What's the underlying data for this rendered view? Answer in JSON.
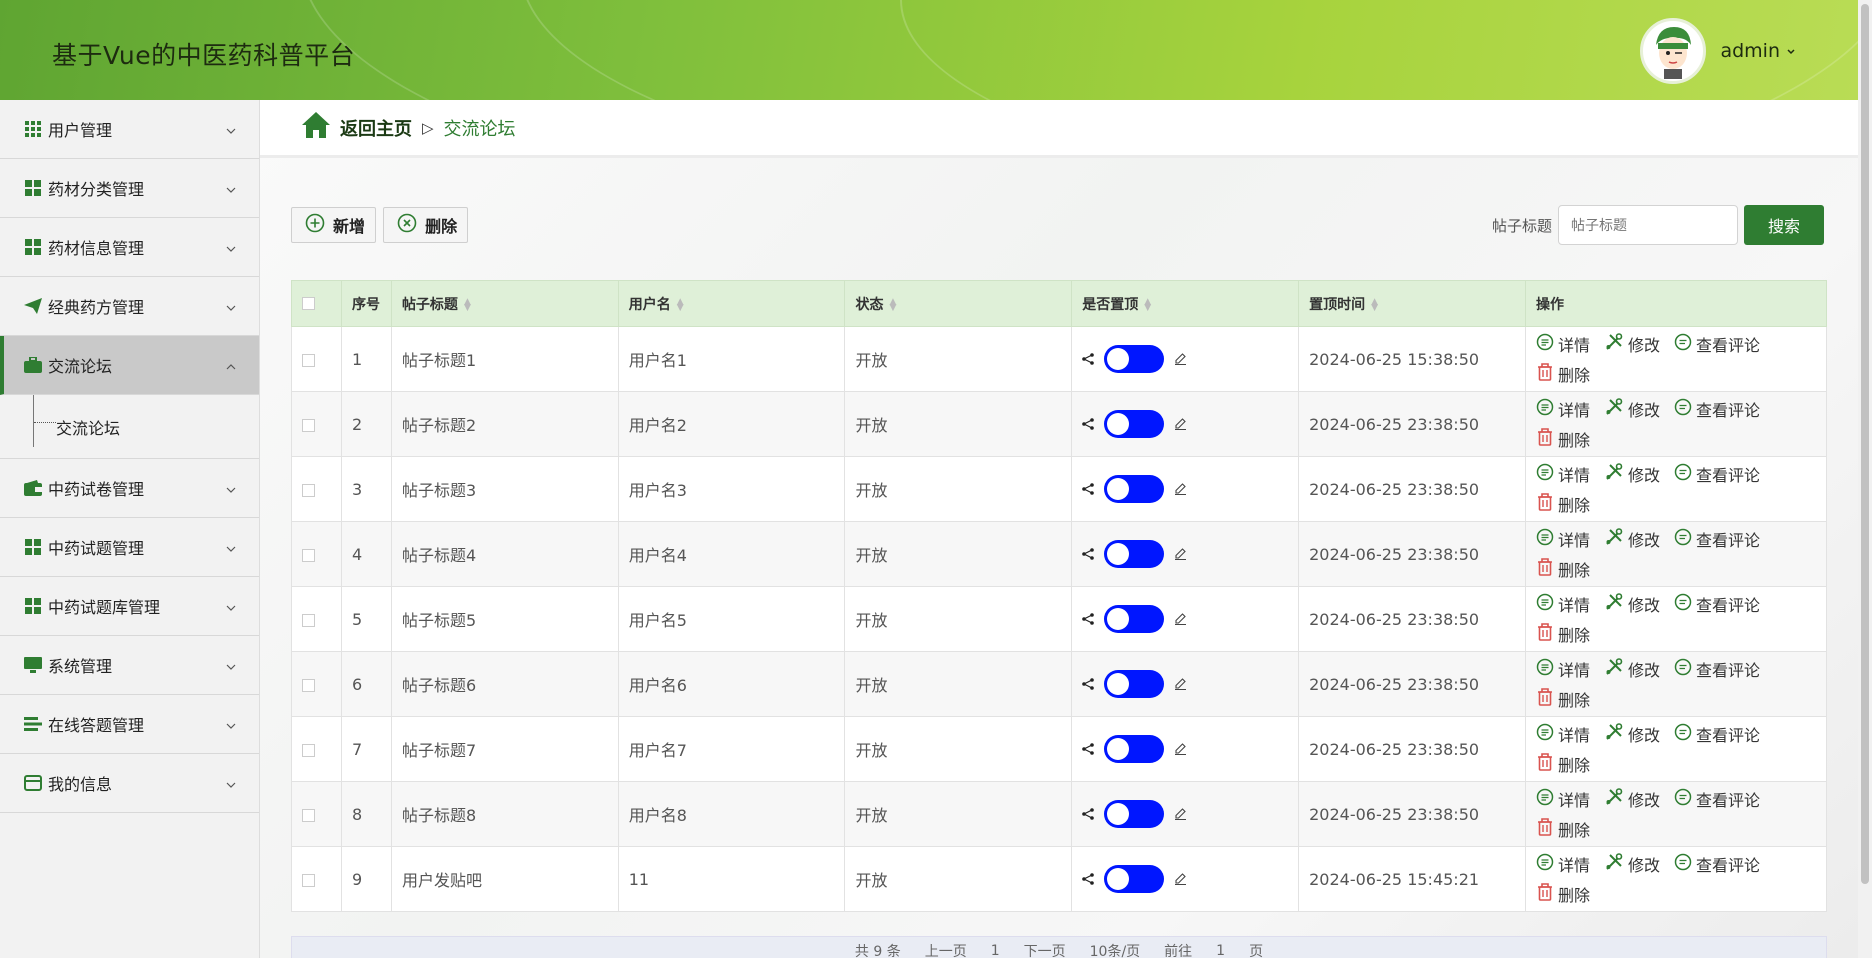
{
  "header": {
    "title": "基于Vue的中医药科普平台",
    "username": "admin"
  },
  "sidebar": {
    "items": [
      {
        "label": "用户管理",
        "icon": "grid-icon"
      },
      {
        "label": "药材分类管理",
        "icon": "apps-icon"
      },
      {
        "label": "药材信息管理",
        "icon": "apps-icon"
      },
      {
        "label": "经典药方管理",
        "icon": "send-icon"
      },
      {
        "label": "交流论坛",
        "icon": "briefcase-icon",
        "active": true,
        "children": [
          "交流论坛"
        ]
      },
      {
        "label": "中药试卷管理",
        "icon": "wallet-icon"
      },
      {
        "label": "中药试题管理",
        "icon": "apps-icon"
      },
      {
        "label": "中药试题库管理",
        "icon": "apps-icon"
      },
      {
        "label": "系统管理",
        "icon": "monitor-icon"
      },
      {
        "label": "在线答题管理",
        "icon": "list-icon"
      },
      {
        "label": "我的信息",
        "icon": "card-icon"
      }
    ]
  },
  "breadcrumb": {
    "home": "返回主页",
    "sep": "▷",
    "current": "交流论坛"
  },
  "toolbar": {
    "add": "新增",
    "delete": "删除"
  },
  "search": {
    "label": "帖子标题",
    "placeholder": "帖子标题",
    "button": "搜索"
  },
  "table": {
    "headers": [
      "序号",
      "帖子标题",
      "用户名",
      "状态",
      "是否置顶",
      "置顶时间",
      "操作"
    ],
    "rows": [
      {
        "no": "1",
        "title": "帖子标题1",
        "user": "用户名1",
        "status": "开放",
        "time": "2024-06-25 15:38:50"
      },
      {
        "no": "2",
        "title": "帖子标题2",
        "user": "用户名2",
        "status": "开放",
        "time": "2024-06-25 23:38:50"
      },
      {
        "no": "3",
        "title": "帖子标题3",
        "user": "用户名3",
        "status": "开放",
        "time": "2024-06-25 23:38:50"
      },
      {
        "no": "4",
        "title": "帖子标题4",
        "user": "用户名4",
        "status": "开放",
        "time": "2024-06-25 23:38:50"
      },
      {
        "no": "5",
        "title": "帖子标题5",
        "user": "用户名5",
        "status": "开放",
        "time": "2024-06-25 23:38:50"
      },
      {
        "no": "6",
        "title": "帖子标题6",
        "user": "用户名6",
        "status": "开放",
        "time": "2024-06-25 23:38:50"
      },
      {
        "no": "7",
        "title": "帖子标题7",
        "user": "用户名7",
        "status": "开放",
        "time": "2024-06-25 23:38:50"
      },
      {
        "no": "8",
        "title": "帖子标题8",
        "user": "用户名8",
        "status": "开放",
        "time": "2024-06-25 23:38:50"
      },
      {
        "no": "9",
        "title": "用户发贴吧",
        "user": "11",
        "status": "开放",
        "time": "2024-06-25 15:45:21"
      }
    ],
    "actions": {
      "detail": "详情",
      "edit": "修改",
      "comments": "查看评论",
      "delete": "删除"
    }
  },
  "colors": {
    "primary": "#2f7d32",
    "switch": "#0016ff",
    "header": "#8cc63f"
  },
  "pagination": {
    "total": "共 9 条",
    "prev": "上一页",
    "page": "1",
    "next": "下一页",
    "page_size": "10条/页",
    "goto": "前往",
    "goto_page": "1",
    "page_unit": "页"
  }
}
